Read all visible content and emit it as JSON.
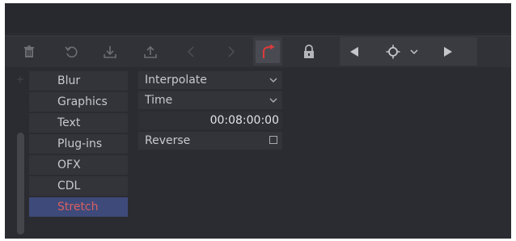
{
  "toolbar": {
    "buttons": [
      {
        "icon": "trash-icon"
      },
      {
        "icon": "reset-icon"
      },
      {
        "icon": "download-icon"
      },
      {
        "icon": "upload-icon"
      },
      {
        "icon": "chevron-left-icon"
      },
      {
        "icon": "chevron-right-icon"
      },
      {
        "icon": "stretch-curve-icon",
        "active": true,
        "color": "#e03a3a"
      },
      {
        "icon": "lock-icon"
      },
      {
        "icon": "play-reverse-icon"
      },
      {
        "icon": "keyframe-icon"
      },
      {
        "icon": "chevron-down-icon"
      },
      {
        "icon": "play-forward-icon"
      }
    ]
  },
  "categories": {
    "items": [
      {
        "label": "Blur"
      },
      {
        "label": "Graphics"
      },
      {
        "label": "Text"
      },
      {
        "label": "Plug-ins"
      },
      {
        "label": "OFX"
      },
      {
        "label": "CDL"
      },
      {
        "label": "Stretch",
        "selected": true
      }
    ],
    "selected_color": "#d86060",
    "selected_bg": "#3e4a7a"
  },
  "properties": {
    "interpolate_label": "Interpolate",
    "time_label": "Time",
    "time_value": "00:08:00:00",
    "reverse_label": "Reverse",
    "reverse_checked": false
  }
}
